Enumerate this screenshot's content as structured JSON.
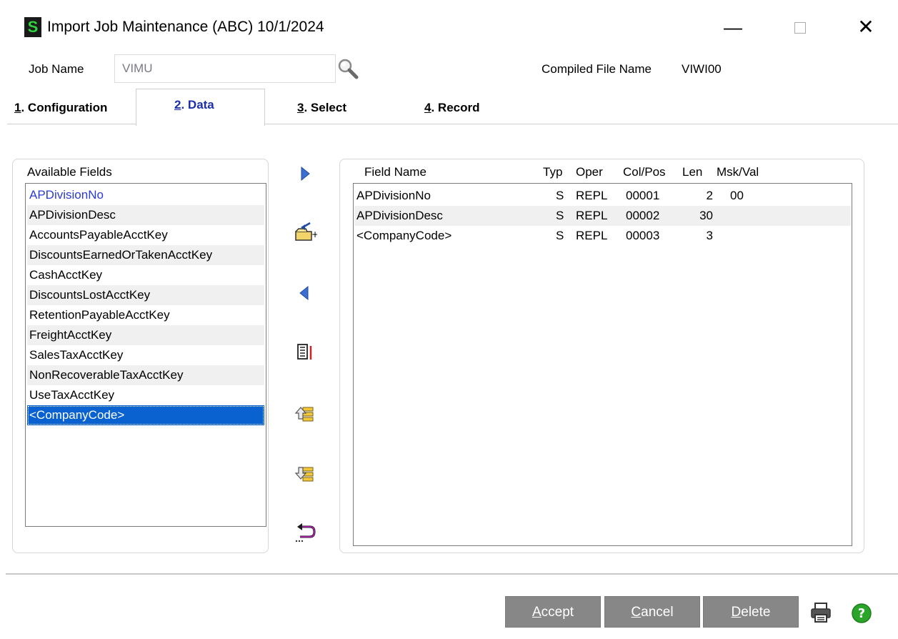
{
  "window": {
    "logo_letter": "S",
    "title": "Import Job Maintenance (ABC) 10/1/2024",
    "minimize": "—",
    "close": "✕"
  },
  "job": {
    "label": "Job Name",
    "value": "VIMU",
    "compiled_label": "Compiled File Name",
    "compiled_value": "VIWI00"
  },
  "tabs": [
    {
      "num": "1",
      "label": ". Configuration",
      "active": false
    },
    {
      "num": "2",
      "label": ". Data",
      "active": true
    },
    {
      "num": "3",
      "label": ". Select",
      "active": false
    },
    {
      "num": "4",
      "label": ". Record",
      "active": false
    }
  ],
  "available": {
    "label": "Available Fields",
    "items": [
      "APDivisionNo",
      "APDivisionDesc",
      "AccountsPayableAcctKey",
      "DiscountsEarnedOrTakenAcctKey",
      "CashAcctKey",
      "DiscountsLostAcctKey",
      "RetentionPayableAcctKey",
      "FreightAcctKey",
      "SalesTaxAcctKey",
      "NonRecoverableTaxAcctKey",
      "UseTaxAcctKey",
      "<CompanyCode>"
    ],
    "selected_index": 11
  },
  "grid": {
    "headers": {
      "field_name": "Field Name",
      "typ": "Typ",
      "oper": "Oper",
      "colpos": "Col/Pos",
      "len": "Len",
      "mskval": "Msk/Val"
    },
    "rows": [
      {
        "field": "APDivisionNo",
        "typ": "S",
        "oper": "REPL",
        "colpos": "00001",
        "len": "2",
        "msk": "00"
      },
      {
        "field": "APDivisionDesc",
        "typ": "S",
        "oper": "REPL",
        "colpos": "00002",
        "len": "30",
        "msk": ""
      },
      {
        "field": "<CompanyCode>",
        "typ": "S",
        "oper": "REPL",
        "colpos": "00003",
        "len": "3",
        "msk": ""
      }
    ]
  },
  "buttons": {
    "accept_first": "A",
    "accept_rest": "ccept",
    "cancel_first": "C",
    "cancel_rest": "ancel",
    "delete_first": "D",
    "delete_rest": "elete"
  },
  "colors": {
    "selected_bg": "#0a62d0",
    "button_bg": "#878787",
    "accent_blue": "#2a3ad8",
    "help_green": "#2aa52a"
  }
}
